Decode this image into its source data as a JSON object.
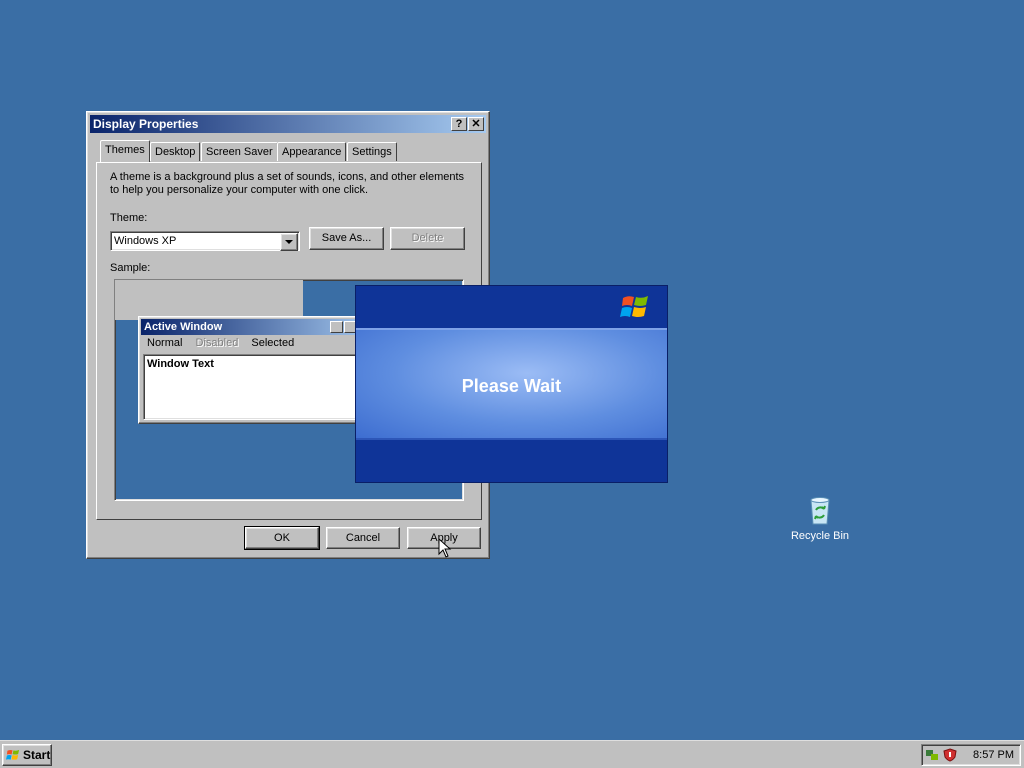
{
  "window": {
    "title": "Display Properties",
    "help_btn": "?",
    "close_btn": "✕",
    "tabs": [
      "Themes",
      "Desktop",
      "Screen Saver",
      "Appearance",
      "Settings"
    ],
    "active_tab": "Themes",
    "description": "A theme is a background plus a set of sounds, icons, and other elements to help you personalize your computer with one click.",
    "theme_label": "Theme:",
    "theme_value": "Windows XP",
    "save_as_label": "Save As...",
    "delete_label": "Delete",
    "sample_label": "Sample:",
    "ok_label": "OK",
    "cancel_label": "Cancel",
    "apply_label": "Apply"
  },
  "sample": {
    "active_window_title": "Active Window",
    "menu": [
      "Normal",
      "Disabled",
      "Selected"
    ],
    "window_text": "Window Text"
  },
  "splash": {
    "text": "Please Wait"
  },
  "desktop_icons": [
    {
      "label": "Recycle Bin",
      "icon": "recycle-bin-icon"
    }
  ],
  "taskbar": {
    "start_label": "Start",
    "clock": "8:57 PM"
  },
  "colors": {
    "desktop": "#3a6ea5",
    "title_start": "#0a246a",
    "title_end": "#a6caf0",
    "splash_dark": "#0f3498",
    "splash_light": "#9bbcf5"
  }
}
